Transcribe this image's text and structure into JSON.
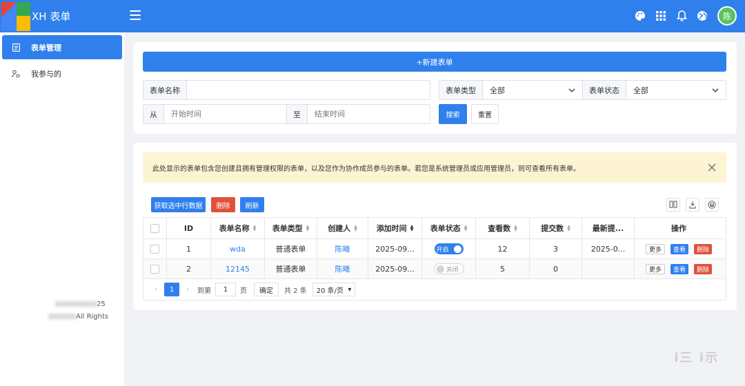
{
  "header": {
    "brand": "XH 表单",
    "avatar_text": "陈",
    "icons": [
      "palette-icon",
      "apps-grid-icon",
      "bell-icon",
      "globe-icon"
    ]
  },
  "sidebar": {
    "items": [
      {
        "label": "表单管理",
        "icon": "document-icon",
        "active": true
      },
      {
        "label": "我参与的",
        "icon": "participants-icon",
        "active": false
      }
    ],
    "footer_line1": "25",
    "footer_line2": "All Rights"
  },
  "toolbar": {
    "new_form_label": "+新建表单"
  },
  "filters": {
    "name_label": "表单名称",
    "name_value": "",
    "type_label": "表单类型",
    "type_value": "全部",
    "status_label": "表单状态",
    "status_value": "全部",
    "from_label": "从",
    "start_placeholder": "开始时间",
    "to_label": "至",
    "end_placeholder": "结束时间",
    "search_label": "搜索",
    "reset_label": "重置"
  },
  "alert": {
    "text": "此处显示的表单包含您创建且拥有管理权限的表单，以及您作为协作成员参与的表单。若您是系统管理员或应用管理员，则可查看所有表单。"
  },
  "table_actions": {
    "get_selected_label": "获取选中行数据",
    "delete_label": "删除",
    "refresh_label": "刷新"
  },
  "table": {
    "columns": [
      "ID",
      "表单名称",
      "表单类型",
      "创建人",
      "添加时间",
      "表单状态",
      "查看数",
      "提交数",
      "最新提...",
      "操作"
    ],
    "rows": [
      {
        "id": "1",
        "name": "wda",
        "type": "普通表单",
        "creator": "陈曦",
        "added": "2025-09...",
        "status": "开启",
        "status_on": true,
        "views": "12",
        "submits": "3",
        "latest": "2025-0..."
      },
      {
        "id": "2",
        "name": "12145",
        "type": "普通表单",
        "creator": "陈曦",
        "added": "2025-09...",
        "status": "关闭",
        "status_on": false,
        "views": "5",
        "submits": "0",
        "latest": ""
      }
    ],
    "row_actions": {
      "more": "更多",
      "view": "查看",
      "delete": "删除"
    }
  },
  "pagination": {
    "current_page": "1",
    "goto_label": "到第",
    "goto_value": "1",
    "page_unit": "页",
    "confirm_label": "确定",
    "total_label": "共 2 条",
    "page_size": "20 条/页"
  },
  "watermark": "ⅰ三 ⅰ示"
}
